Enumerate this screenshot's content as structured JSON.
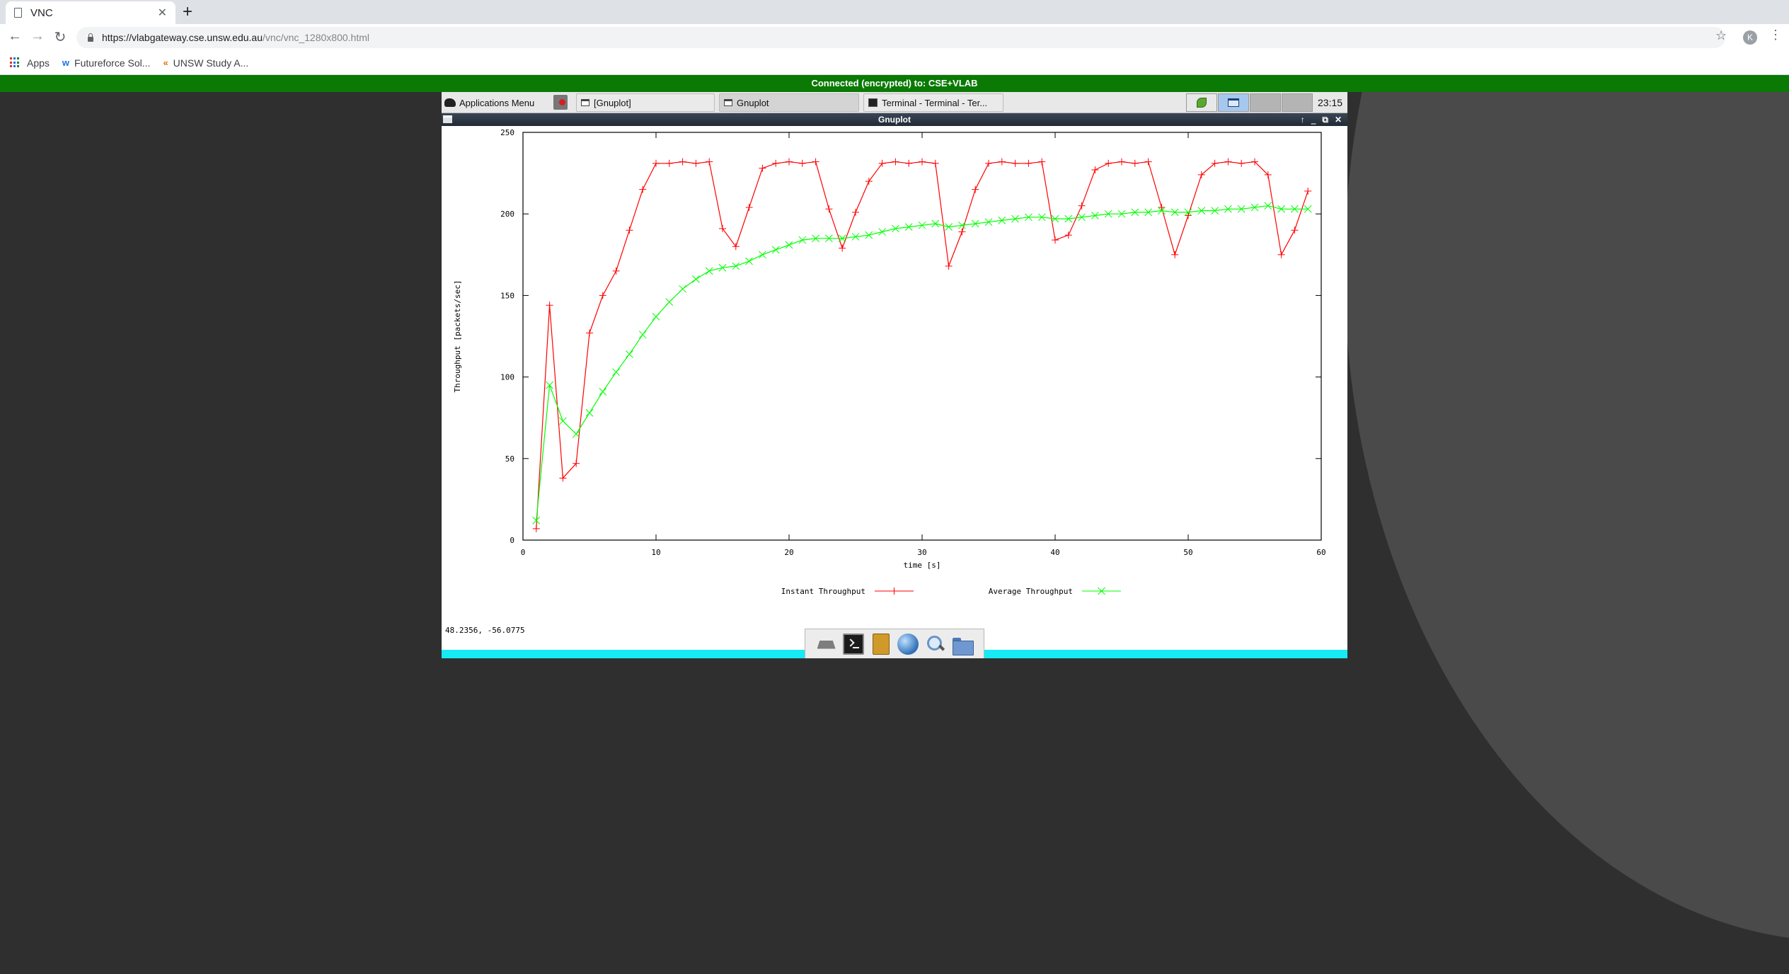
{
  "browser": {
    "tab_title": "VNC",
    "tab_close": "✕",
    "new_tab": "+",
    "nav": {
      "back": "←",
      "forward": "→",
      "reload": "↻"
    },
    "url_host": "https://vlabgateway.cse.unsw.edu.au",
    "url_path": "/vnc/vnc_1280x800.html",
    "star": "☆",
    "profile_initial": "K",
    "menu": "⋮",
    "bookmarks": [
      {
        "label": "Apps",
        "icon": "apps-grid-icon"
      },
      {
        "label": "Futureforce Sol...",
        "icon": "futureforce-icon",
        "glyph": "w"
      },
      {
        "label": "UNSW Study A...",
        "icon": "unsw-icon",
        "glyph": "«"
      }
    ]
  },
  "vnc": {
    "status": "Connected (encrypted) to: CSE+VLAB",
    "status_color": "#0a7a05"
  },
  "desktop": {
    "panel": {
      "apps_menu": "Applications Menu",
      "tasks": [
        {
          "label": "[Gnuplot]",
          "icon": "window-icon",
          "active": false
        },
        {
          "label": "Gnuplot",
          "icon": "window-icon",
          "active": true
        },
        {
          "label": "Terminal - Terminal - Ter...",
          "icon": "terminal-icon",
          "active": false
        }
      ],
      "clock": "23:15"
    },
    "window": {
      "title": "Gnuplot",
      "controls": {
        "up": "↑",
        "minimize": "‗",
        "maximize": "⧉",
        "close": "✕"
      },
      "coords_readout": "48.2356, -56.0775"
    },
    "dock": [
      "desktop-icon",
      "terminal-icon",
      "notes-icon",
      "web-browser-icon",
      "search-icon",
      "file-manager-icon"
    ]
  },
  "chart_data": {
    "type": "line",
    "title": "",
    "xlabel": "time [s]",
    "ylabel": "Throughput [packets/sec]",
    "xlim": [
      0,
      60
    ],
    "ylim": [
      0,
      250
    ],
    "xticks": [
      0,
      10,
      20,
      30,
      40,
      50,
      60
    ],
    "yticks": [
      0,
      50,
      100,
      150,
      200,
      250
    ],
    "grid": false,
    "legend_position": "bottom",
    "series": [
      {
        "name": "Instant Throughput",
        "color": "#ff0000",
        "marker": "+",
        "x": [
          1,
          2,
          3,
          4,
          5,
          6,
          7,
          8,
          9,
          10,
          11,
          12,
          13,
          14,
          15,
          16,
          17,
          18,
          19,
          20,
          21,
          22,
          23,
          24,
          25,
          26,
          27,
          28,
          29,
          30,
          31,
          32,
          33,
          34,
          35,
          36,
          37,
          38,
          39,
          40,
          41,
          42,
          43,
          44,
          45,
          46,
          47,
          48,
          49,
          50,
          51,
          52,
          53,
          54,
          55,
          56,
          57,
          58,
          59
        ],
        "values": [
          7,
          144,
          38,
          47,
          127,
          150,
          165,
          190,
          215,
          231,
          231,
          232,
          231,
          232,
          191,
          180,
          204,
          228,
          231,
          232,
          231,
          232,
          203,
          179,
          201,
          220,
          231,
          232,
          231,
          232,
          231,
          168,
          189,
          215,
          231,
          232,
          231,
          231,
          232,
          184,
          187,
          205,
          227,
          231,
          232,
          231,
          232,
          204,
          175,
          199,
          224,
          231,
          232,
          231,
          232,
          224,
          175,
          190,
          214
        ]
      },
      {
        "name": "Average Throughput",
        "color": "#00ff00",
        "marker": "x",
        "x": [
          1,
          2,
          3,
          4,
          5,
          6,
          7,
          8,
          9,
          10,
          11,
          12,
          13,
          14,
          15,
          16,
          17,
          18,
          19,
          20,
          21,
          22,
          23,
          24,
          25,
          26,
          27,
          28,
          29,
          30,
          31,
          32,
          33,
          34,
          35,
          36,
          37,
          38,
          39,
          40,
          41,
          42,
          43,
          44,
          45,
          46,
          47,
          48,
          49,
          50,
          51,
          52,
          53,
          54,
          55,
          56,
          57,
          58,
          59
        ],
        "values": [
          12,
          95,
          73,
          65,
          78,
          91,
          103,
          114,
          126,
          137,
          146,
          154,
          160,
          165,
          167,
          168,
          171,
          175,
          178,
          181,
          184,
          185,
          185,
          185,
          186,
          187,
          189,
          191,
          192,
          193,
          194,
          192,
          193,
          194,
          195,
          196,
          197,
          198,
          198,
          197,
          197,
          198,
          199,
          200,
          200,
          201,
          201,
          202,
          201,
          201,
          202,
          202,
          203,
          203,
          204,
          205,
          203,
          203,
          203
        ]
      }
    ]
  }
}
